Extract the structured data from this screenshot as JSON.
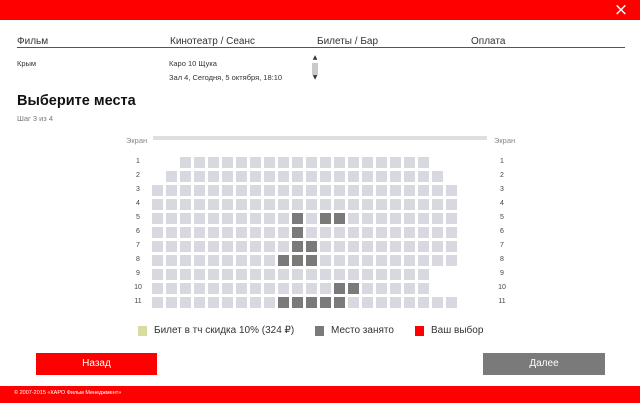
{
  "header": {
    "close_label": "×"
  },
  "steps": [
    "Фильм",
    "Кинотеатр / Сеанс",
    "Билеты / Бар",
    "Оплата"
  ],
  "order": {
    "film": "Крым",
    "cinema": "Каро 10 Щука",
    "session": "Зал 4, Сегодня, 5 октября, 18:10"
  },
  "page": {
    "title": "Выберите места",
    "subtitle": "Шаг 3 из 4"
  },
  "screen_label": "Экран",
  "colors": {
    "accent": "#ff0000",
    "free_seat": "#d8d8e0",
    "occupied_seat": "#7a7a7a",
    "discount_seat": "#d8dca0"
  },
  "hall": {
    "row_labels": [
      "1",
      "2",
      "3",
      "4",
      "5",
      "6",
      "7",
      "8",
      "9",
      "10",
      "11"
    ],
    "occupied": [
      [
        5,
        11
      ],
      [
        5,
        13
      ],
      [
        5,
        14
      ],
      [
        6,
        11
      ],
      [
        7,
        11
      ],
      [
        7,
        12
      ],
      [
        8,
        10
      ],
      [
        8,
        11
      ],
      [
        8,
        12
      ],
      [
        10,
        14
      ],
      [
        10,
        15
      ],
      [
        11,
        10
      ],
      [
        11,
        11
      ],
      [
        11,
        12
      ],
      [
        11,
        13
      ],
      [
        11,
        14
      ]
    ]
  },
  "legend": {
    "discount": "Билет в тч скидка 10% (324 ₽)",
    "occupied": "Место занято",
    "selected": "Ваш выбор"
  },
  "buttons": {
    "back": "Назад",
    "next": "Далее"
  },
  "footer": {
    "copyright": "© 2007-2015 «КАРО Фильм Менеджмент»"
  }
}
